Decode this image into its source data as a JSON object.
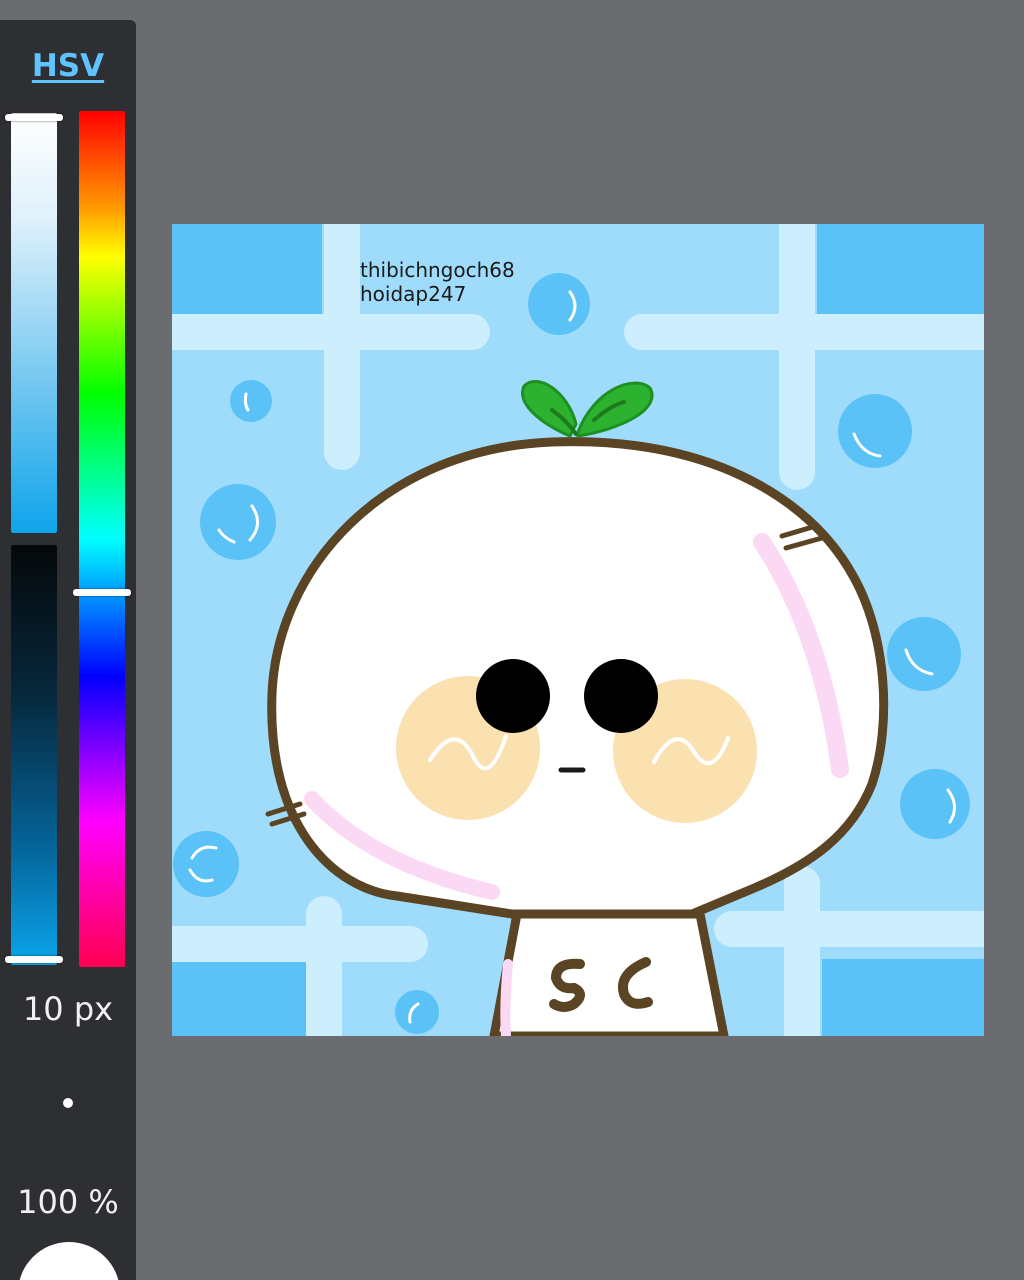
{
  "color_panel": {
    "mode_label": "HSV",
    "brush_size": "10 px",
    "opacity": "100 %",
    "current_color": "#ffffff",
    "hue_color": "#0ea4ea"
  },
  "canvas": {
    "watermark_line1": "thibichngoch68",
    "watermark_line2": "hoidap247",
    "background_color": "#9fdcfb"
  }
}
